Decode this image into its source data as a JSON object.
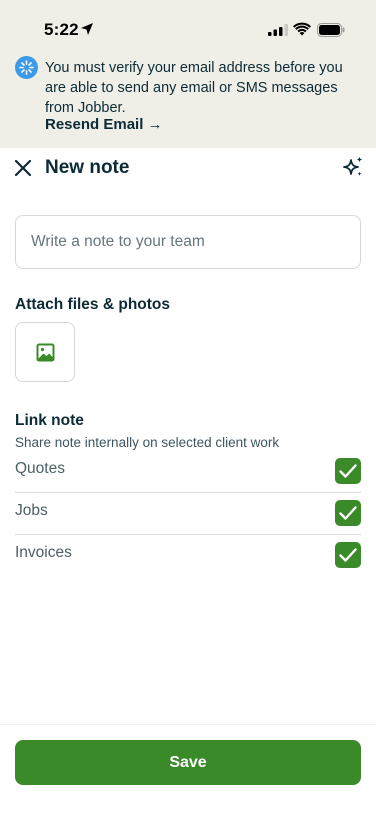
{
  "status_bar": {
    "time": "5:22"
  },
  "banner": {
    "message": "You must verify your email address before you are able to send any email or SMS messages from Jobber.",
    "link_label": "Resend Email →",
    "icon_color": "#3d9ae8"
  },
  "header": {
    "title": "New note",
    "close_icon": "close-icon",
    "ai_icon": "sparkle-icon"
  },
  "note": {
    "value": "",
    "placeholder": "Write a note to your team"
  },
  "attach": {
    "title": "Attach files & photos",
    "icon": "image-icon"
  },
  "link_note": {
    "title": "Link note",
    "subtitle": "Share note internally on selected client work",
    "items": [
      {
        "label": "Quotes",
        "checked": true
      },
      {
        "label": "Jobs",
        "checked": true
      },
      {
        "label": "Invoices",
        "checked": true
      }
    ]
  },
  "footer": {
    "save_label": "Save"
  },
  "colors": {
    "accent": "#3b8a2a",
    "banner_bg": "#efefe8",
    "text": "#0d2b36"
  }
}
